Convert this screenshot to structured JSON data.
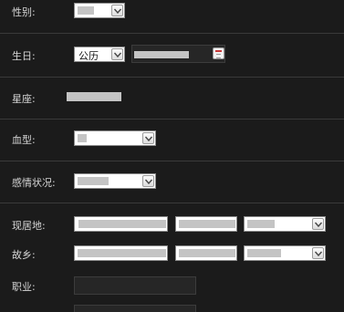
{
  "form": {
    "gender": {
      "label": "性别:"
    },
    "birthday": {
      "label": "生日:",
      "calendar_type": "公历"
    },
    "zodiac": {
      "label": "星座:"
    },
    "blood_type": {
      "label": "血型:"
    },
    "relationship": {
      "label": "感情状况:"
    },
    "residence": {
      "label": "现居地:"
    },
    "hometown": {
      "label": "故乡:"
    },
    "occupation": {
      "label": "职业:"
    }
  }
}
